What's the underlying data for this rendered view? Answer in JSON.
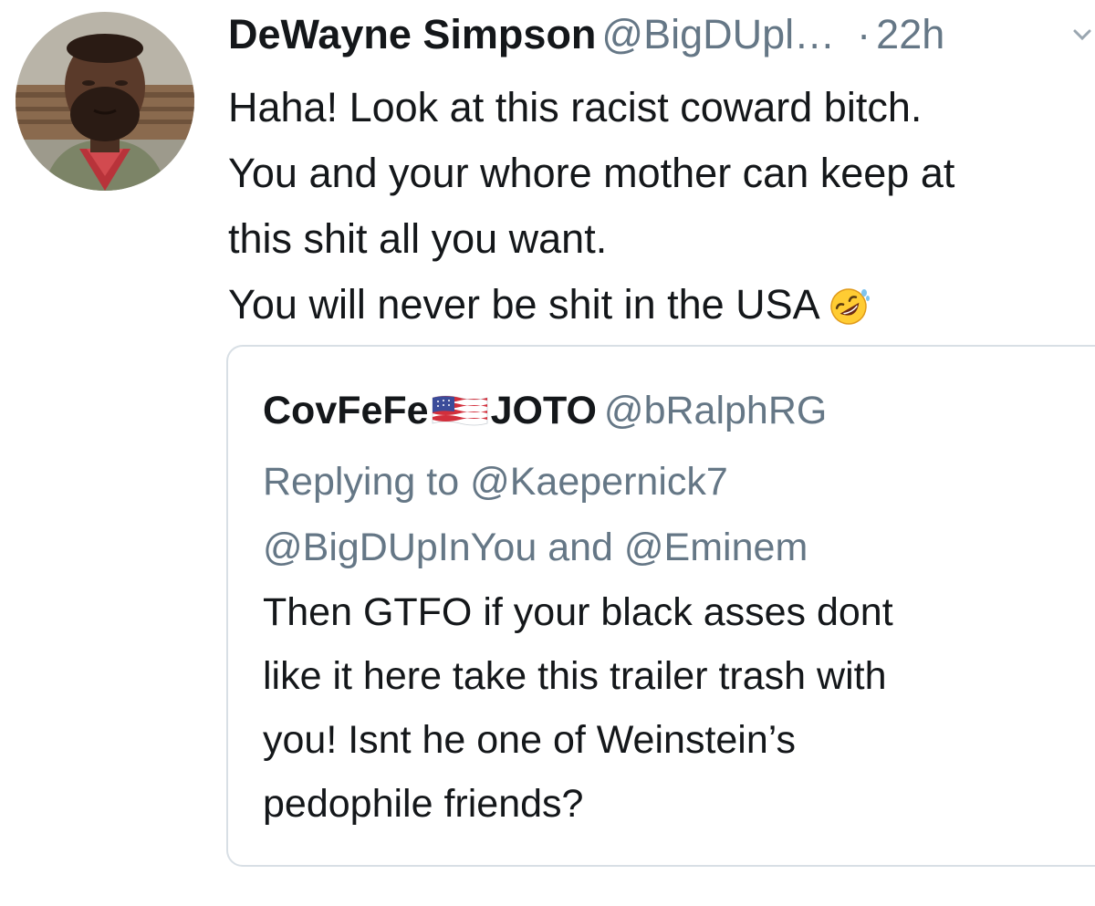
{
  "tweet": {
    "author": {
      "name": "DeWayne Simpson",
      "handle": "@BigDUpl…",
      "avatar_icon": "profile-photo"
    },
    "separator": "·",
    "timestamp": "22h",
    "menu_icon": "chevron-down-icon",
    "text_lines": [
      "Haha! Look at this racist coward bitch.",
      "You and your whore mother can keep at",
      "this shit all you want.",
      "You will never be shit in the USA"
    ],
    "emoji": "rolling-on-the-floor-laughing"
  },
  "quoted_tweet": {
    "name_part1": "CovFeFe",
    "flag_icon": "us-flag-icon",
    "name_part2": "JOTO",
    "handle": "@bRalphRG",
    "replying_to_label": "Replying to",
    "replying_to_first": "@Kaepernick7",
    "replying_to_second": "@BigDUpInYou",
    "replying_to_joiner": "and",
    "replying_to_third": "@Eminem",
    "text_lines": [
      "Then GTFO if your black asses dont",
      "like it here take this trailer trash with",
      "you!  Isnt he one of Weinstein’s",
      "pedophile friends?"
    ]
  },
  "colors": {
    "primary_text": "#14171a",
    "secondary_text": "#657786",
    "border": "#d8dfe5"
  }
}
